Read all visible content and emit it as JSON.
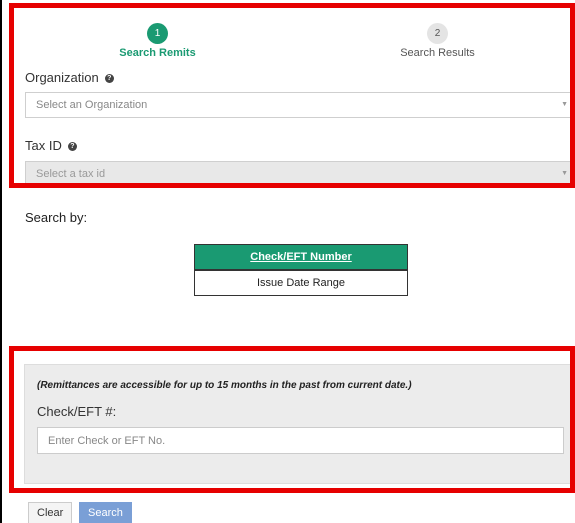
{
  "stepper": {
    "steps": [
      {
        "number": "1",
        "label": "Search Remits",
        "state": "active"
      },
      {
        "number": "2",
        "label": "Search Results",
        "state": "inactive"
      }
    ]
  },
  "organization": {
    "label": "Organization",
    "help_icon": "help-icon",
    "placeholder": "Select an Organization"
  },
  "tax_id": {
    "label": "Tax ID",
    "help_icon": "help-icon",
    "placeholder": "Select a tax id"
  },
  "search_by": {
    "label": "Search by:",
    "options": [
      {
        "label": "Check/EFT Number",
        "active": true
      },
      {
        "label": "Issue Date Range",
        "active": false
      }
    ]
  },
  "check_panel": {
    "note": "(Remittances are accessible for up to 15 months in the past from current date.)",
    "field_label": "Check/EFT #:",
    "placeholder": "Enter Check or EFT No."
  },
  "actions": {
    "clear_label": "Clear",
    "search_label": "Search"
  },
  "colors": {
    "accent": "#1a9a72",
    "highlight_border": "#e60000",
    "search_button": "#7a9fd6"
  }
}
